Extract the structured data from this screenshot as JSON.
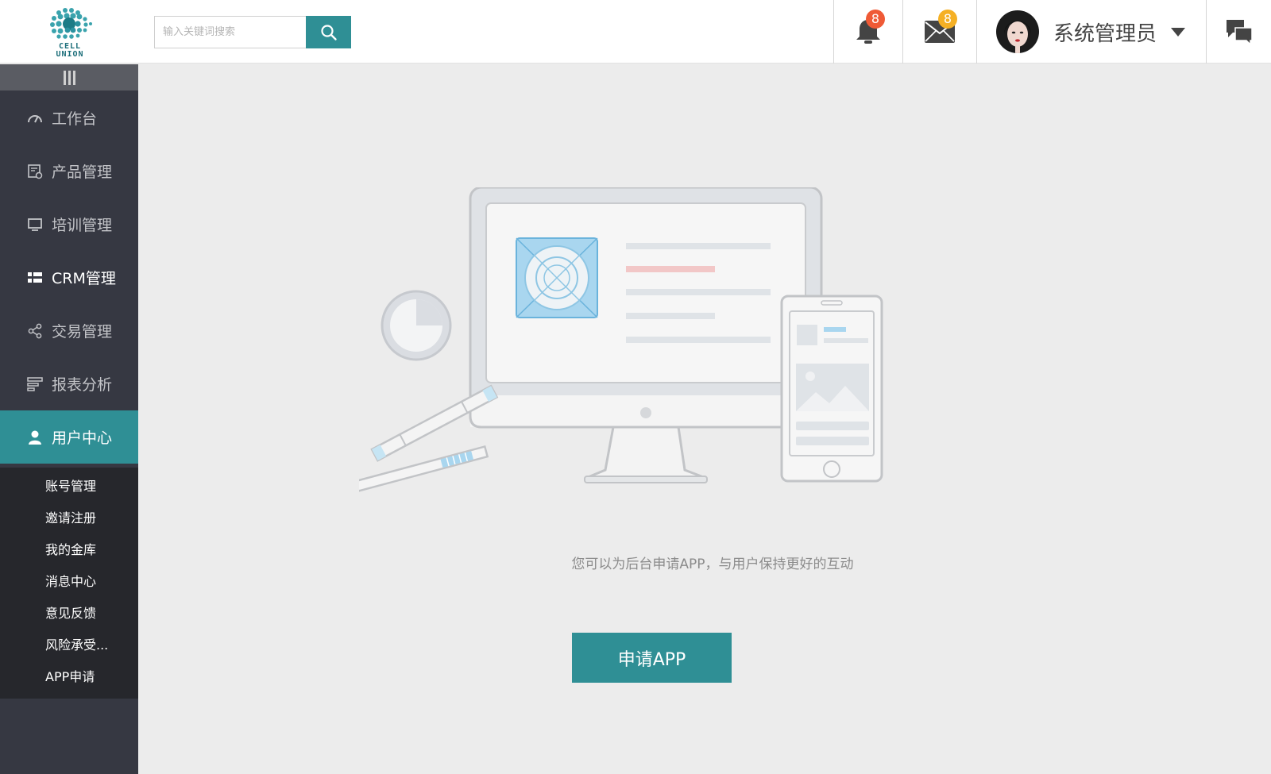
{
  "header": {
    "logo_text_line1": "CELL",
    "logo_text_line2": "UNION",
    "search_placeholder": "输入关键词搜索",
    "notifications_count": "8",
    "messages_count": "8",
    "user_name": "系统管理员",
    "colors": {
      "accent": "#2f8f95",
      "badge_red": "#ef5a36",
      "badge_yellow": "#f5b025"
    }
  },
  "sidebar": {
    "items": [
      {
        "label": "工作台",
        "icon": "gauge-icon"
      },
      {
        "label": "产品管理",
        "icon": "product-list-icon"
      },
      {
        "label": "培训管理",
        "icon": "monitor-icon"
      },
      {
        "label": "CRM管理",
        "icon": "grid-icon"
      },
      {
        "label": "交易管理",
        "icon": "share-icon"
      },
      {
        "label": "报表分析",
        "icon": "report-icon"
      },
      {
        "label": "用户中心",
        "icon": "user-icon"
      }
    ],
    "sub_items": [
      {
        "label": "账号管理"
      },
      {
        "label": "邀请注册"
      },
      {
        "label": "我的金库"
      },
      {
        "label": "消息中心"
      },
      {
        "label": "意见反馈"
      },
      {
        "label": "风险承受..."
      },
      {
        "label": "APP申请"
      }
    ]
  },
  "main": {
    "message": "您可以为后台申请APP，与用户保持更好的互动",
    "apply_button": "申请APP"
  }
}
